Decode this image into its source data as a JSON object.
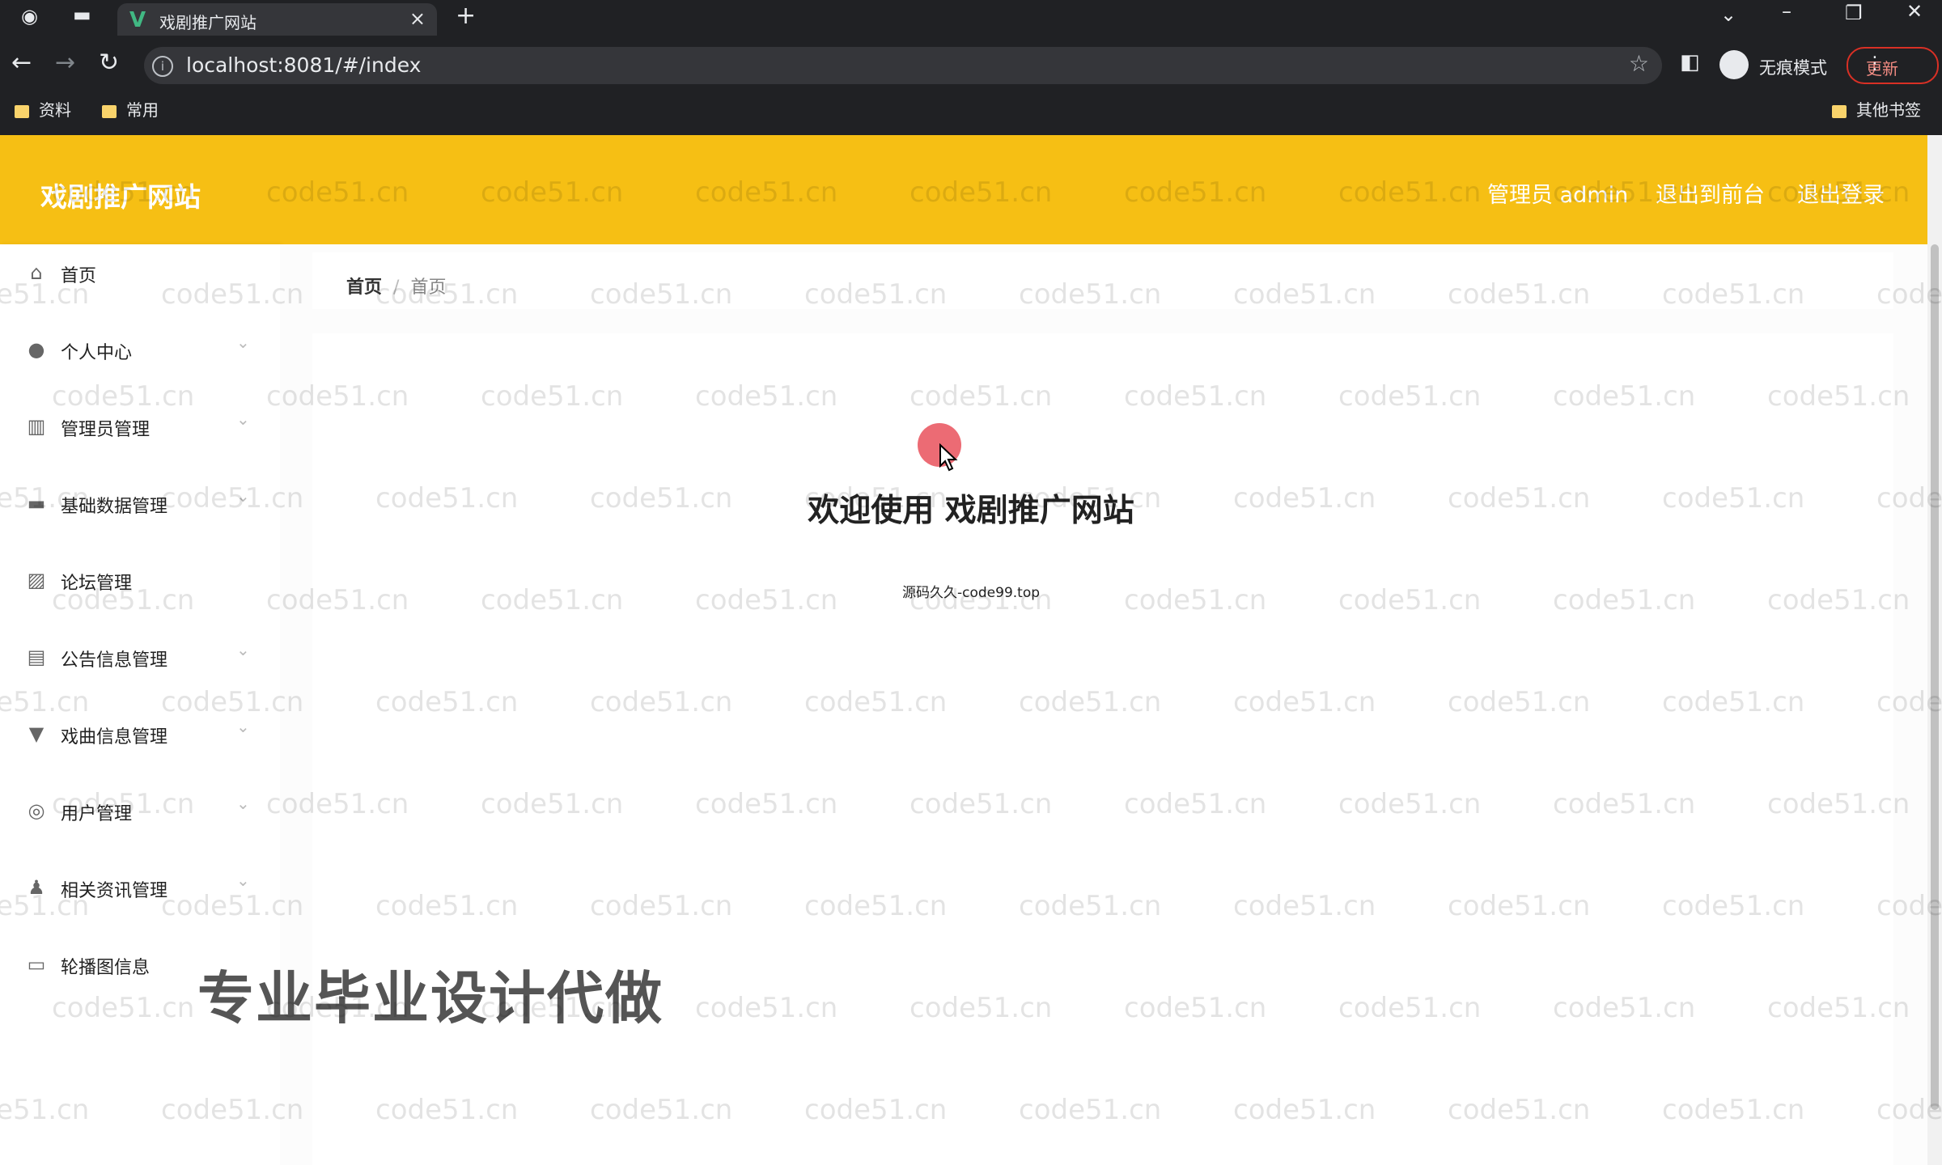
{
  "browser": {
    "tab_title": "戏剧推广网站",
    "tab_close": "×",
    "new_tab": "+",
    "url": "localhost:8081/#/index",
    "incognito_label": "无痕模式",
    "update_label": "更新",
    "bookmarks": [
      "资料",
      "常用"
    ],
    "other_bookmarks": "其他书签"
  },
  "header": {
    "brand": "戏剧推广网站",
    "user": "管理员 admin",
    "back_to_front": "退出到前台",
    "logout": "退出登录"
  },
  "sidebar": {
    "items": [
      {
        "label": "首页",
        "icon": "home-icon"
      },
      {
        "label": "个人中心",
        "icon": "user-icon"
      },
      {
        "label": "管理员管理",
        "icon": "bar-chart-icon"
      },
      {
        "label": "基础数据管理",
        "icon": "monitor-icon"
      },
      {
        "label": "论坛管理",
        "icon": "image-icon"
      },
      {
        "label": "公告信息管理",
        "icon": "clipboard-icon"
      },
      {
        "label": "戏曲信息管理",
        "icon": "trophy-icon"
      },
      {
        "label": "用户管理",
        "icon": "compass-icon"
      },
      {
        "label": "相关资讯管理",
        "icon": "person-icon"
      },
      {
        "label": "轮播图信息",
        "icon": "printer-icon"
      }
    ]
  },
  "breadcrumb": {
    "home": "首页",
    "current": "首页"
  },
  "main": {
    "welcome": "欢迎使用 戏剧推广网站",
    "note": "源码久久-code99.top",
    "overlay": "专业毕业设计代做"
  },
  "watermark": "code51.cn",
  "colors": {
    "header": "#f6bf14",
    "chrome": "#202124"
  }
}
